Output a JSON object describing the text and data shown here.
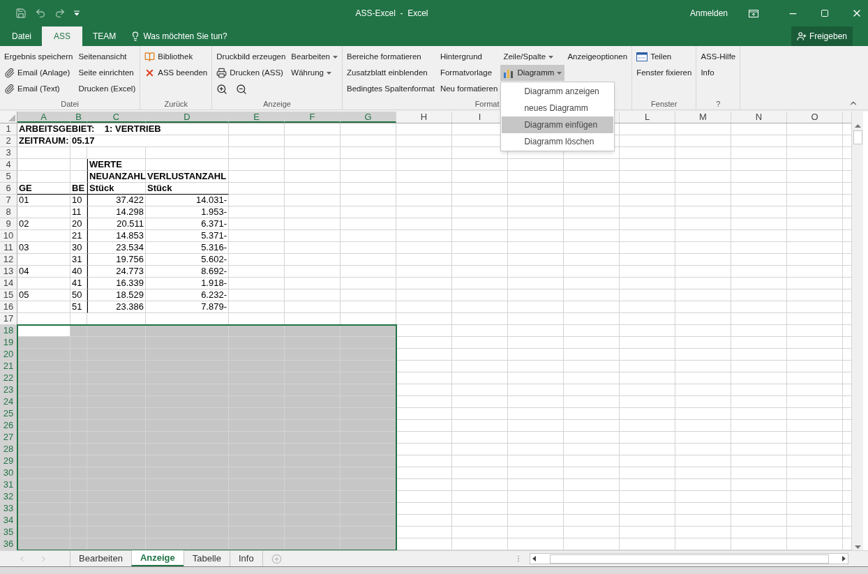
{
  "window": {
    "title": "ASS-Excel  -  Excel",
    "account": "Anmelden"
  },
  "menu_tabs": [
    {
      "label": "Datei",
      "selected": false
    },
    {
      "label": "ASS",
      "selected": true
    },
    {
      "label": "TEAM",
      "selected": false
    }
  ],
  "tell_me": {
    "placeholder": "Was möchten Sie tun?"
  },
  "share_button": {
    "label": "Freigeben"
  },
  "ribbon": {
    "groups": [
      {
        "label": "Datei",
        "columns": [
          [
            {
              "label": "Ergebnis speichern",
              "kind": "text"
            },
            {
              "label": "Email (Anlage)",
              "kind": "mail"
            },
            {
              "label": "Email (Text)",
              "kind": "mail"
            }
          ],
          [
            {
              "label": "Seitenansicht",
              "kind": "text"
            },
            {
              "label": "Seite einrichten",
              "kind": "text"
            },
            {
              "label": "Drucken (Excel)",
              "kind": "text"
            }
          ]
        ]
      },
      {
        "label": "Zurück",
        "columns": [
          [
            {
              "label": "Bibliothek",
              "kind": "book"
            },
            {
              "label": "ASS beenden",
              "kind": "close"
            }
          ]
        ]
      },
      {
        "label": "Anzeige",
        "columns": [
          [
            {
              "label": "Druckbild erzeugen",
              "kind": "text"
            },
            {
              "label": "Drucken (ASS)",
              "kind": "print"
            },
            {
              "kind": "zoom"
            }
          ],
          [
            {
              "label": "Bearbeiten",
              "kind": "text",
              "dropdown": true
            },
            {
              "label": "Währung",
              "kind": "text",
              "dropdown": true
            }
          ]
        ]
      },
      {
        "label": "Format",
        "columns": [
          [
            {
              "label": "Bereiche formatieren",
              "kind": "text"
            },
            {
              "label": "Zusatzblatt einblenden",
              "kind": "text"
            },
            {
              "label": "Bedingtes Spaltenformat",
              "kind": "text"
            }
          ],
          [
            {
              "label": "Hintergrund",
              "kind": "text"
            },
            {
              "label": "Formatvorlage",
              "kind": "text"
            },
            {
              "label": "Neu formatieren",
              "kind": "text"
            }
          ],
          [
            {
              "label": "Zeile/Spalte",
              "kind": "text",
              "dropdown": true
            },
            {
              "label": "Diagramm",
              "kind": "chart",
              "dropdown": true,
              "expanded": true,
              "menu": [
                {
                  "label": "Diagramm anzeigen",
                  "selected": false
                },
                {
                  "label": "neues Diagramm",
                  "selected": false
                },
                {
                  "label": "Diagramm einfügen",
                  "selected": true
                },
                {
                  "label": "Diagramm löschen",
                  "selected": false
                }
              ]
            }
          ],
          [
            {
              "label": "Anzeigeoptionen",
              "kind": "text"
            }
          ]
        ]
      },
      {
        "label": "Fenster",
        "columns": [
          [
            {
              "label": "Teilen",
              "kind": "split"
            },
            {
              "label": "Fenster fixieren",
              "kind": "text"
            }
          ]
        ]
      },
      {
        "label": "?",
        "columns": [
          [
            {
              "label": "ASS-Hilfe",
              "kind": "text"
            },
            {
              "label": "Info",
              "kind": "text"
            }
          ]
        ]
      }
    ]
  },
  "sheet": {
    "columns": [
      {
        "label": "A",
        "selected": true
      },
      {
        "label": "B",
        "selected": true
      },
      {
        "label": "C",
        "selected": true
      },
      {
        "label": "D",
        "selected": true
      },
      {
        "label": "E",
        "selected": true
      },
      {
        "label": "F",
        "selected": true
      },
      {
        "label": "G",
        "selected": true
      },
      {
        "label": "H",
        "selected": false
      },
      {
        "label": "I",
        "selected": false
      },
      {},
      {},
      {
        "label": "L",
        "selected": false
      },
      {
        "label": "M",
        "selected": false
      },
      {
        "label": "N",
        "selected": false
      },
      {
        "label": "O",
        "selected": false
      }
    ],
    "rows": [
      {
        "number": "1",
        "kind": "title",
        "a": "ARBEITSGEBIET:    1: VERTRIEB",
        "selected": false
      },
      {
        "number": "2",
        "kind": "title",
        "a": "ZEITRAUM:",
        "b": "05.17",
        "selected": false
      },
      {
        "number": "3",
        "kind": "empty",
        "selected": false
      },
      {
        "number": "4",
        "kind": "header",
        "c": "WERTE",
        "selected": false
      },
      {
        "number": "5",
        "kind": "header",
        "c": "NEUANZAHL",
        "d": "VERLUSTANZAHL",
        "selected": false
      },
      {
        "number": "6",
        "kind": "header_last",
        "a": "GE",
        "b": "BE",
        "c": "Stück",
        "d": "Stück",
        "selected": false
      },
      {
        "number": "7",
        "kind": "data",
        "a": "01",
        "b": "10",
        "c": "37.422",
        "d": "14.031-",
        "selected": false
      },
      {
        "number": "8",
        "kind": "data",
        "b": "11",
        "c": "14.298",
        "d": "1.953-",
        "selected": false
      },
      {
        "number": "9",
        "kind": "data",
        "a": "02",
        "b": "20",
        "c": "20.511",
        "d": "6.371-",
        "selected": false
      },
      {
        "number": "10",
        "kind": "data",
        "b": "21",
        "c": "14.853",
        "d": "5.371-",
        "selected": false
      },
      {
        "number": "11",
        "kind": "data",
        "a": "03",
        "b": "30",
        "c": "23.534",
        "d": "5.316-",
        "selected": false
      },
      {
        "number": "12",
        "kind": "data",
        "b": "31",
        "c": "19.756",
        "d": "5.602-",
        "selected": false
      },
      {
        "number": "13",
        "kind": "data",
        "a": "04",
        "b": "40",
        "c": "24.773",
        "d": "8.692-",
        "selected": false
      },
      {
        "number": "14",
        "kind": "data",
        "b": "41",
        "c": "16.339",
        "d": "1.918-",
        "selected": false
      },
      {
        "number": "15",
        "kind": "data",
        "a": "05",
        "b": "50",
        "c": "18.529",
        "d": "6.232-",
        "selected": false
      },
      {
        "number": "16",
        "kind": "data",
        "b": "51",
        "c": "23.386",
        "d": "7.879-",
        "selected": false
      },
      {
        "number": "17",
        "kind": "empty",
        "selected": false
      },
      {
        "number": "18",
        "kind": "empty",
        "selected": true,
        "cursor": true
      },
      {
        "number": "19",
        "kind": "empty",
        "selected": true,
        "cursor": false
      },
      {
        "number": "20",
        "kind": "empty",
        "selected": true,
        "cursor": false
      },
      {
        "number": "21",
        "kind": "empty",
        "selected": true,
        "cursor": false
      },
      {
        "number": "22",
        "kind": "empty",
        "selected": true,
        "cursor": false
      },
      {
        "number": "23",
        "kind": "empty",
        "selected": true,
        "cursor": false
      },
      {
        "number": "24",
        "kind": "empty",
        "selected": true,
        "cursor": false
      },
      {
        "number": "25",
        "kind": "empty",
        "selected": true,
        "cursor": false
      },
      {
        "number": "26",
        "kind": "empty",
        "selected": true,
        "cursor": false
      },
      {
        "number": "27",
        "kind": "empty",
        "selected": true,
        "cursor": false
      },
      {
        "number": "28",
        "kind": "empty",
        "selected": true,
        "cursor": false
      },
      {
        "number": "29",
        "kind": "empty",
        "selected": true,
        "cursor": false
      },
      {
        "number": "30",
        "kind": "empty",
        "selected": true,
        "cursor": false
      },
      {
        "number": "31",
        "kind": "empty",
        "selected": true,
        "cursor": false
      },
      {
        "number": "32",
        "kind": "empty",
        "selected": true,
        "cursor": false
      },
      {
        "number": "33",
        "kind": "empty",
        "selected": true,
        "cursor": false
      },
      {
        "number": "34",
        "kind": "empty",
        "selected": true,
        "cursor": false
      },
      {
        "number": "35",
        "kind": "empty",
        "selected": true,
        "cursor": false
      },
      {
        "number": "36",
        "kind": "empty",
        "selected": true,
        "cursor": false
      }
    ]
  },
  "sheet_tabs": [
    {
      "label": "Bearbeiten",
      "selected": false
    },
    {
      "label": "Anzeige",
      "selected": true
    },
    {
      "label": "Tabelle",
      "selected": false
    },
    {
      "label": "Info",
      "selected": false
    }
  ]
}
